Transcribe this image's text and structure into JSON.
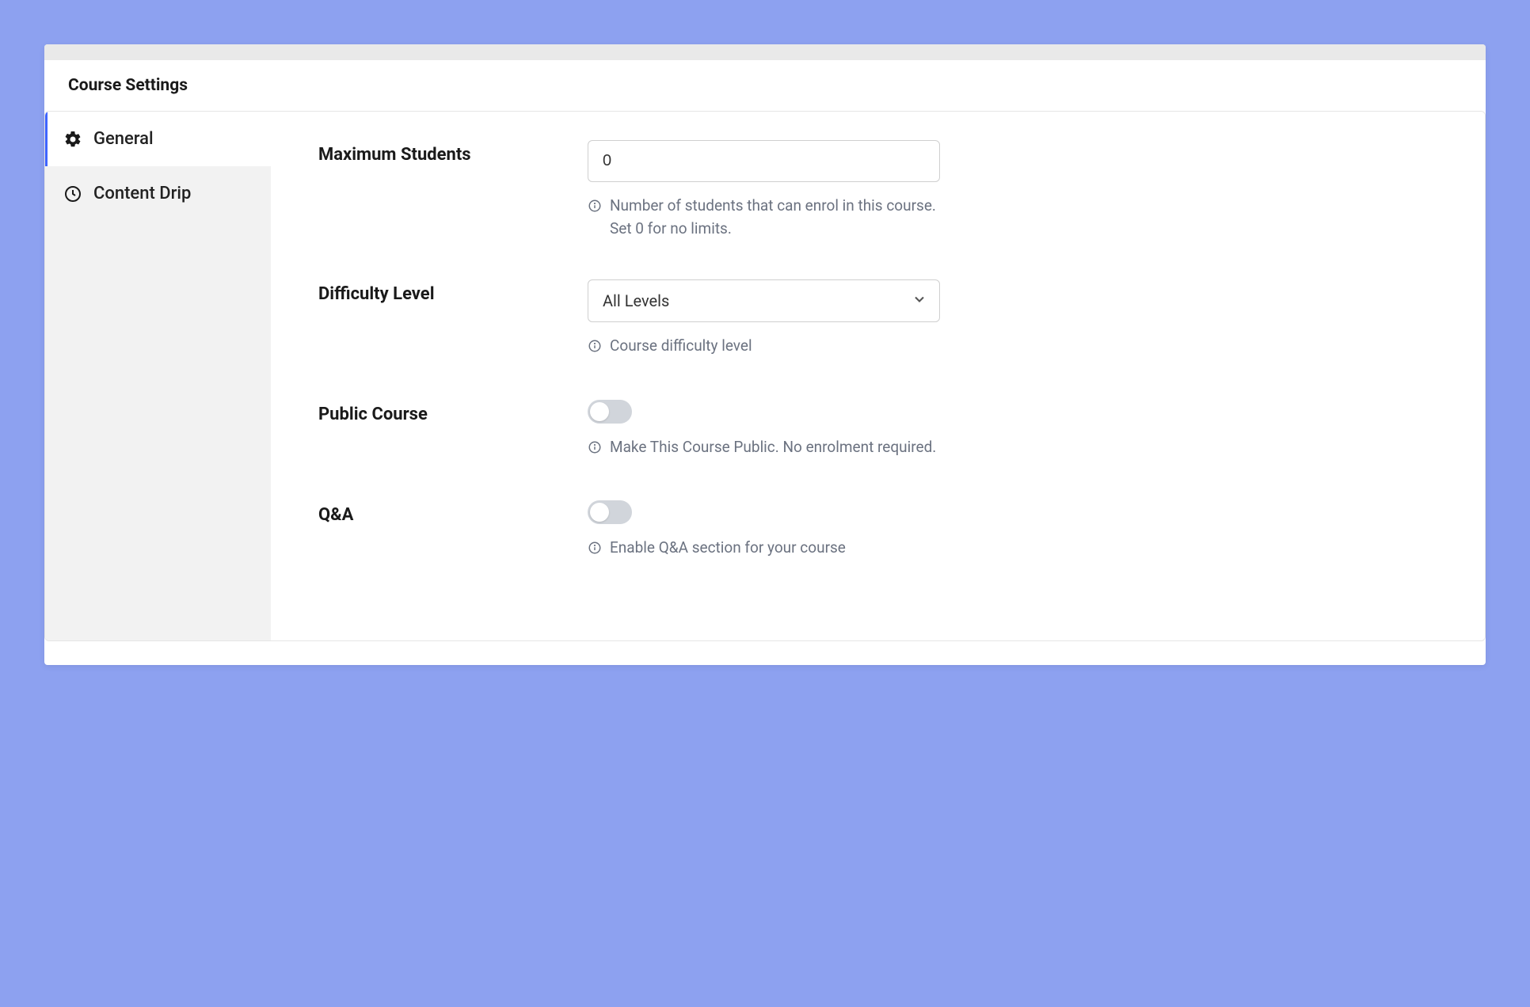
{
  "page_title": "Course Settings",
  "tabs": {
    "general": "General",
    "content_drip": "Content Drip"
  },
  "form": {
    "max_students": {
      "label": "Maximum Students",
      "value": "0",
      "hint": "Number of students that can enrol in this course. Set 0 for no limits."
    },
    "difficulty": {
      "label": "Difficulty Level",
      "value": "All Levels",
      "hint": "Course difficulty level"
    },
    "public_course": {
      "label": "Public Course",
      "hint": "Make This Course Public. No enrolment required."
    },
    "qa": {
      "label": "Q&A",
      "hint": "Enable Q&A section for your course"
    }
  }
}
